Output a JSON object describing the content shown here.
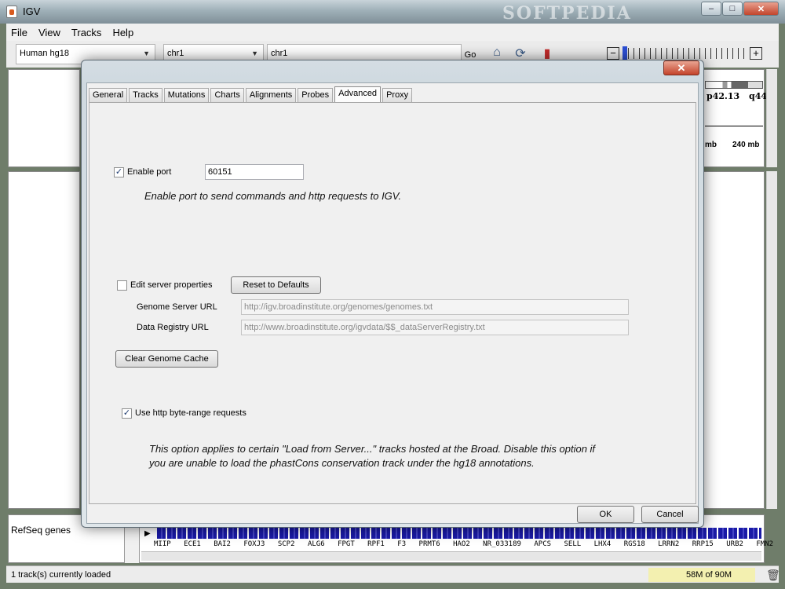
{
  "window": {
    "title": "IGV",
    "watermark": "SOFTPEDIA",
    "min": "–",
    "max": "□",
    "close": "✕"
  },
  "menu": [
    "File",
    "View",
    "Tracks",
    "Help"
  ],
  "toolbar": {
    "genome": "Human hg18",
    "chromosome": "chr1",
    "locus": "chr1",
    "go_label": "Go",
    "zoom_out": "−",
    "zoom_in": "+",
    "zoom_level_fraction": 0.0
  },
  "ideogram": {
    "band_left": "p42.13",
    "band_right": "q44",
    "ruler_left": "mb",
    "ruler_right": "240 mb"
  },
  "feature_track": {
    "name": "RefSeq genes",
    "genes": [
      "MIIP",
      "ECE1",
      "BAI2",
      "FOXJ3",
      "SCP2",
      "ALG6",
      "FPGT",
      "RPF1",
      "F3",
      "PRMT6",
      "HAO2",
      "NR_033189",
      "APCS",
      "SELL",
      "LHX4",
      "RGS18",
      "LRRN2",
      "RRP15",
      "URB2",
      "FMN2"
    ]
  },
  "status": {
    "message": "1 track(s) currently loaded",
    "memory": "58M of 90M"
  },
  "dialog": {
    "close": "✕",
    "tabs": [
      "General",
      "Tracks",
      "Mutations",
      "Charts",
      "Alignments",
      "Probes",
      "Advanced",
      "Proxy"
    ],
    "active_tab": "Advanced",
    "enable_port": {
      "label": "Enable port",
      "checked": true,
      "value": "60151"
    },
    "port_note": "Enable port to send commands and http requests to IGV.",
    "edit_server": {
      "label": "Edit server properties",
      "checked": false
    },
    "reset_button": "Reset to Defaults",
    "genome_server": {
      "label": "Genome Server URL",
      "value": "http://igv.broadinstitute.org/genomes/genomes.txt"
    },
    "data_registry": {
      "label": "Data Registry URL",
      "value": "http://www.broadinstitute.org/igvdata/$$_dataServerRegistry.txt"
    },
    "clear_cache_button": "Clear Genome Cache",
    "byte_range": {
      "label": "Use http byte-range requests",
      "checked": true
    },
    "byte_range_note_1": "This option applies to certain \"Load from Server...\" tracks hosted at the Broad. Disable this option if",
    "byte_range_note_2": "you are unable to load the phastCons conservation track under the hg18 annotations.",
    "ok": "OK",
    "cancel": "Cancel"
  },
  "icons": {
    "home": "home-icon",
    "refresh": "refresh-icon",
    "region": "region-of-interest-icon",
    "trash": "trash-icon",
    "check": "✓"
  }
}
